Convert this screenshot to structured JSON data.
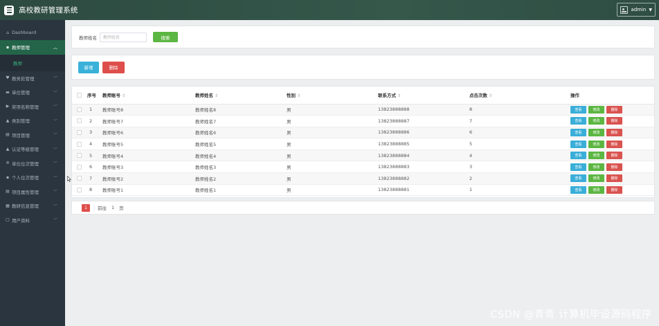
{
  "header": {
    "title": "高校教研管理系统",
    "user": "admin"
  },
  "sidebar": {
    "items": [
      {
        "icon": "⌂",
        "label": "Dashboard",
        "chevron": false,
        "active": false
      },
      {
        "icon": "▪",
        "label": "教师管理",
        "chevron": true,
        "active": true,
        "open": true,
        "sub": "教师"
      },
      {
        "icon": "♥",
        "label": "教务处管理",
        "chevron": true
      },
      {
        "icon": "▬",
        "label": "单位管理",
        "chevron": true
      },
      {
        "icon": "▶",
        "label": "奖项名称管理",
        "chevron": true
      },
      {
        "icon": "▲",
        "label": "类别管理",
        "chevron": true
      },
      {
        "icon": "▤",
        "label": "项目管理",
        "chevron": true
      },
      {
        "icon": "▲",
        "label": "认证等级管理",
        "chevron": true
      },
      {
        "icon": "✲",
        "label": "单位位次管理",
        "chevron": true
      },
      {
        "icon": "▪",
        "label": "个人位次管理",
        "chevron": true
      },
      {
        "icon": "▤",
        "label": "项目属性管理",
        "chevron": true
      },
      {
        "icon": "▦",
        "label": "教研信息管理",
        "chevron": true
      },
      {
        "icon": "□",
        "label": "用户资料",
        "chevron": true
      }
    ]
  },
  "search": {
    "label": "教师姓名",
    "placeholder": "教师姓名",
    "button": "搜索"
  },
  "actions": {
    "add": "新增",
    "delete": "删除"
  },
  "table": {
    "columns": [
      "序号",
      "教师账号",
      "教师姓名",
      "性别",
      "联系方式",
      "点击次数",
      "操作"
    ],
    "sortable": [
      "",
      "⇕",
      "⇕",
      "⇕",
      "⇕",
      "⇕",
      ""
    ],
    "rows": [
      [
        "1",
        "教师账号8",
        "教师姓名8",
        "男",
        "13823888888",
        "8"
      ],
      [
        "2",
        "教师账号7",
        "教师姓名7",
        "男",
        "13823888887",
        "7"
      ],
      [
        "3",
        "教师账号6",
        "教师姓名6",
        "男",
        "13823888886",
        "6"
      ],
      [
        "4",
        "教师账号5",
        "教师姓名5",
        "男",
        "13823888885",
        "5"
      ],
      [
        "5",
        "教师账号4",
        "教师姓名4",
        "男",
        "13823888884",
        "4"
      ],
      [
        "6",
        "教师账号3",
        "教师姓名3",
        "男",
        "13823888883",
        "3"
      ],
      [
        "7",
        "教师账号2",
        "教师姓名2",
        "男",
        "13823888882",
        "2"
      ],
      [
        "8",
        "教师账号1",
        "教师姓名1",
        "男",
        "13823888881",
        "1"
      ]
    ],
    "ops": {
      "view": "查看",
      "edit": "修改",
      "delete": "删除"
    }
  },
  "pager": {
    "current": "1",
    "goto": "前往",
    "page_input": "1",
    "unit": "页"
  },
  "watermark": "CSDN @青青  计算机毕设源码程序"
}
